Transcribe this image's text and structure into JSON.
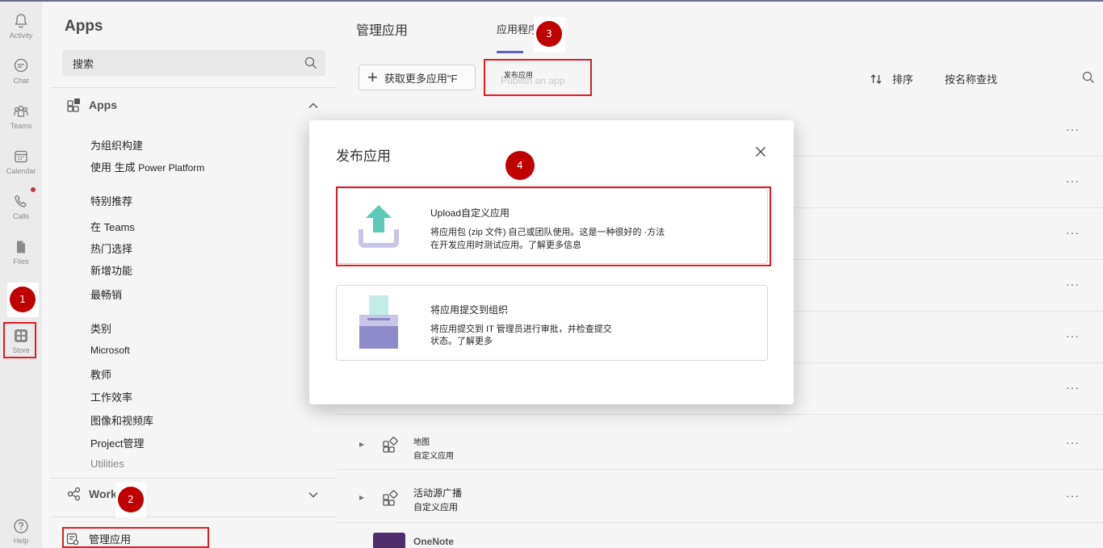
{
  "rail": {
    "items": [
      {
        "label": "Activity"
      },
      {
        "label": "Chat"
      },
      {
        "label": "Teams"
      },
      {
        "label": "Calendar"
      },
      {
        "label": "Calls"
      },
      {
        "label": "Files"
      },
      {
        "label": "Store"
      },
      {
        "label": "Help"
      }
    ]
  },
  "panel": {
    "title": "Apps",
    "search_placeholder": "搜索",
    "apps_section": "Apps",
    "nav": {
      "build_for_org": "为组织构建",
      "use_generate": "使用 生成",
      "power_platform": "Power Platform",
      "featured": "特别推荐",
      "in_teams": "在 Teams",
      "popular": "热门选择",
      "whats_new": "新增功能",
      "top_picks": "最畅销",
      "categories": "类别",
      "microsoft": "Microsoft",
      "education": "教师",
      "productivity": "工作效率",
      "image_video": "图像和视频库",
      "project_mgmt": "Project管理",
      "utilities": "Utilities"
    },
    "workflows_section": "Work",
    "manage_apps": "管理应用"
  },
  "main": {
    "tabs": {
      "manage": "管理应用",
      "apps": "应用程序"
    },
    "toolbar": {
      "get_more": "获取更多应用\"F",
      "publish": "发布应用",
      "publish_ghost": "Publish an app",
      "sort": "排序",
      "filter": "按名称查找"
    },
    "rows": [
      {
        "name": "地图",
        "sub": "自定义应用"
      },
      {
        "name": "活动源广播",
        "sub": "自定义应用"
      }
    ],
    "partial_row_text": "OneNote"
  },
  "dialog": {
    "title": "发布应用",
    "option1": {
      "title": "Upload自定义应用",
      "line1": "将应用包 (zip 文件) 自己或团队使用。这是一种很好的 ·方法",
      "line2": "在开发应用时测试应用。了解更多信息"
    },
    "option2": {
      "title": "将应用提交到组织",
      "line1": "将应用提交到 IT 管理员进行审批，并检查提交",
      "line2": "状态。了解更多"
    }
  },
  "annotations": {
    "step1": "1",
    "step2": "2",
    "step3": "3",
    "step4": "4"
  },
  "colors": {
    "accent": "#5b5fc7",
    "annotation_red": "#e01b24",
    "badge_red": "#c00000",
    "upload_teal": "#5fc9b8",
    "art_purple": "#c8c6e8"
  }
}
